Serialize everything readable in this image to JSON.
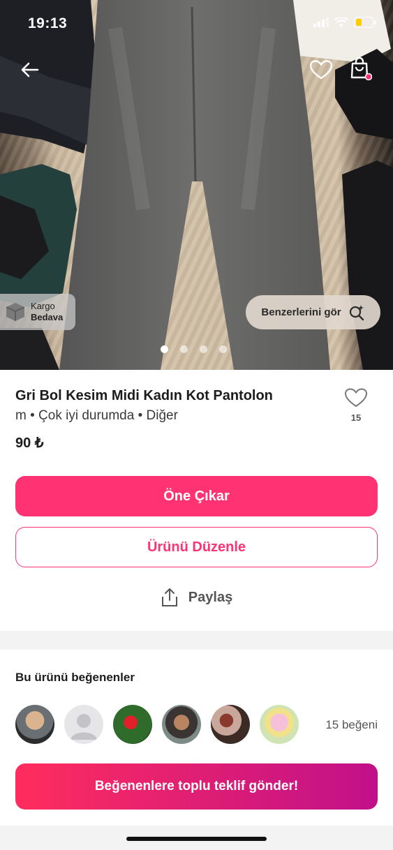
{
  "status_bar": {
    "time": "19:13"
  },
  "hero": {
    "badge_line1": "Kargo",
    "badge_line2": "Bedava",
    "similar_label": "Benzerlerini gör",
    "dots_total": 4,
    "active_dot": 1
  },
  "product": {
    "title": "Gri Bol Kesim Midi Kadın Kot Pantolon",
    "meta": "m • Çok iyi durumda • Diğer",
    "price": "90 ₺",
    "like_count": "15"
  },
  "actions": {
    "promote_label": "Öne Çıkar",
    "edit_label": "Ürünü Düzenle",
    "share_label": "Paylaş"
  },
  "likers": {
    "heading": "Bu ürünü beğenenler",
    "count_label": "15 beğeni",
    "offer_label": "Beğenenlere toplu teklif gönder!"
  },
  "colors": {
    "accent": "#ff3374",
    "gradient_start": "#ff2d5d",
    "gradient_end": "#c0108a"
  }
}
